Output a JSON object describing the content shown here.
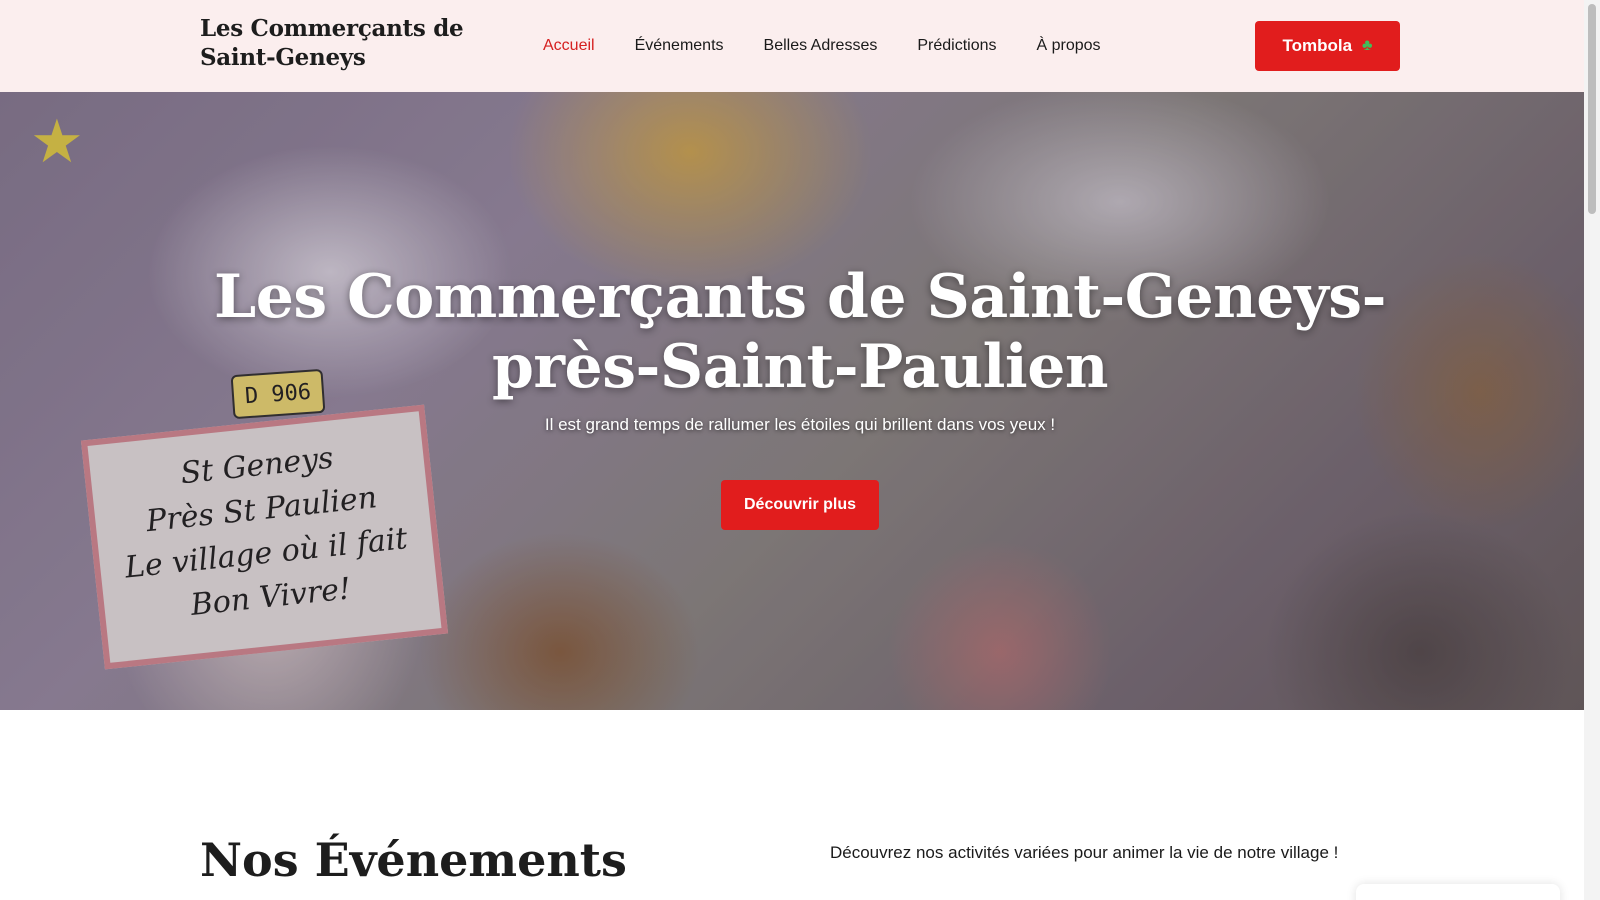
{
  "header": {
    "brand_line1": "Les Commerçants de",
    "brand_line2": "Saint-Geneys",
    "nav": [
      {
        "label": "Accueil",
        "active": true
      },
      {
        "label": "Événements",
        "active": false
      },
      {
        "label": "Belles Adresses",
        "active": false
      },
      {
        "label": "Prédictions",
        "active": false
      },
      {
        "label": "À propos",
        "active": false
      }
    ],
    "tombola_label": "Tombola",
    "tombola_icon": "clover-icon"
  },
  "hero": {
    "title_line1": "Les Commerçants de Saint-Geneys-",
    "title_line2": "près-Saint-Paulien",
    "subtitle": "Il est grand temps de rallumer les étoiles qui brillent dans vos yeux !",
    "cta_label": "Découvrir plus",
    "plate_text": "D 906",
    "sign_text": [
      "St Geneys",
      "Près St Paulien",
      "Le village où il fait",
      "Bon Vivre!"
    ]
  },
  "events": {
    "title": "Nos Événements",
    "intro": "Découvrez nos activités variées pour animer la vie de notre village !"
  },
  "colors": {
    "accent": "#e11d1d",
    "header_bg": "#fbeeee",
    "nav_active": "#d52020"
  }
}
